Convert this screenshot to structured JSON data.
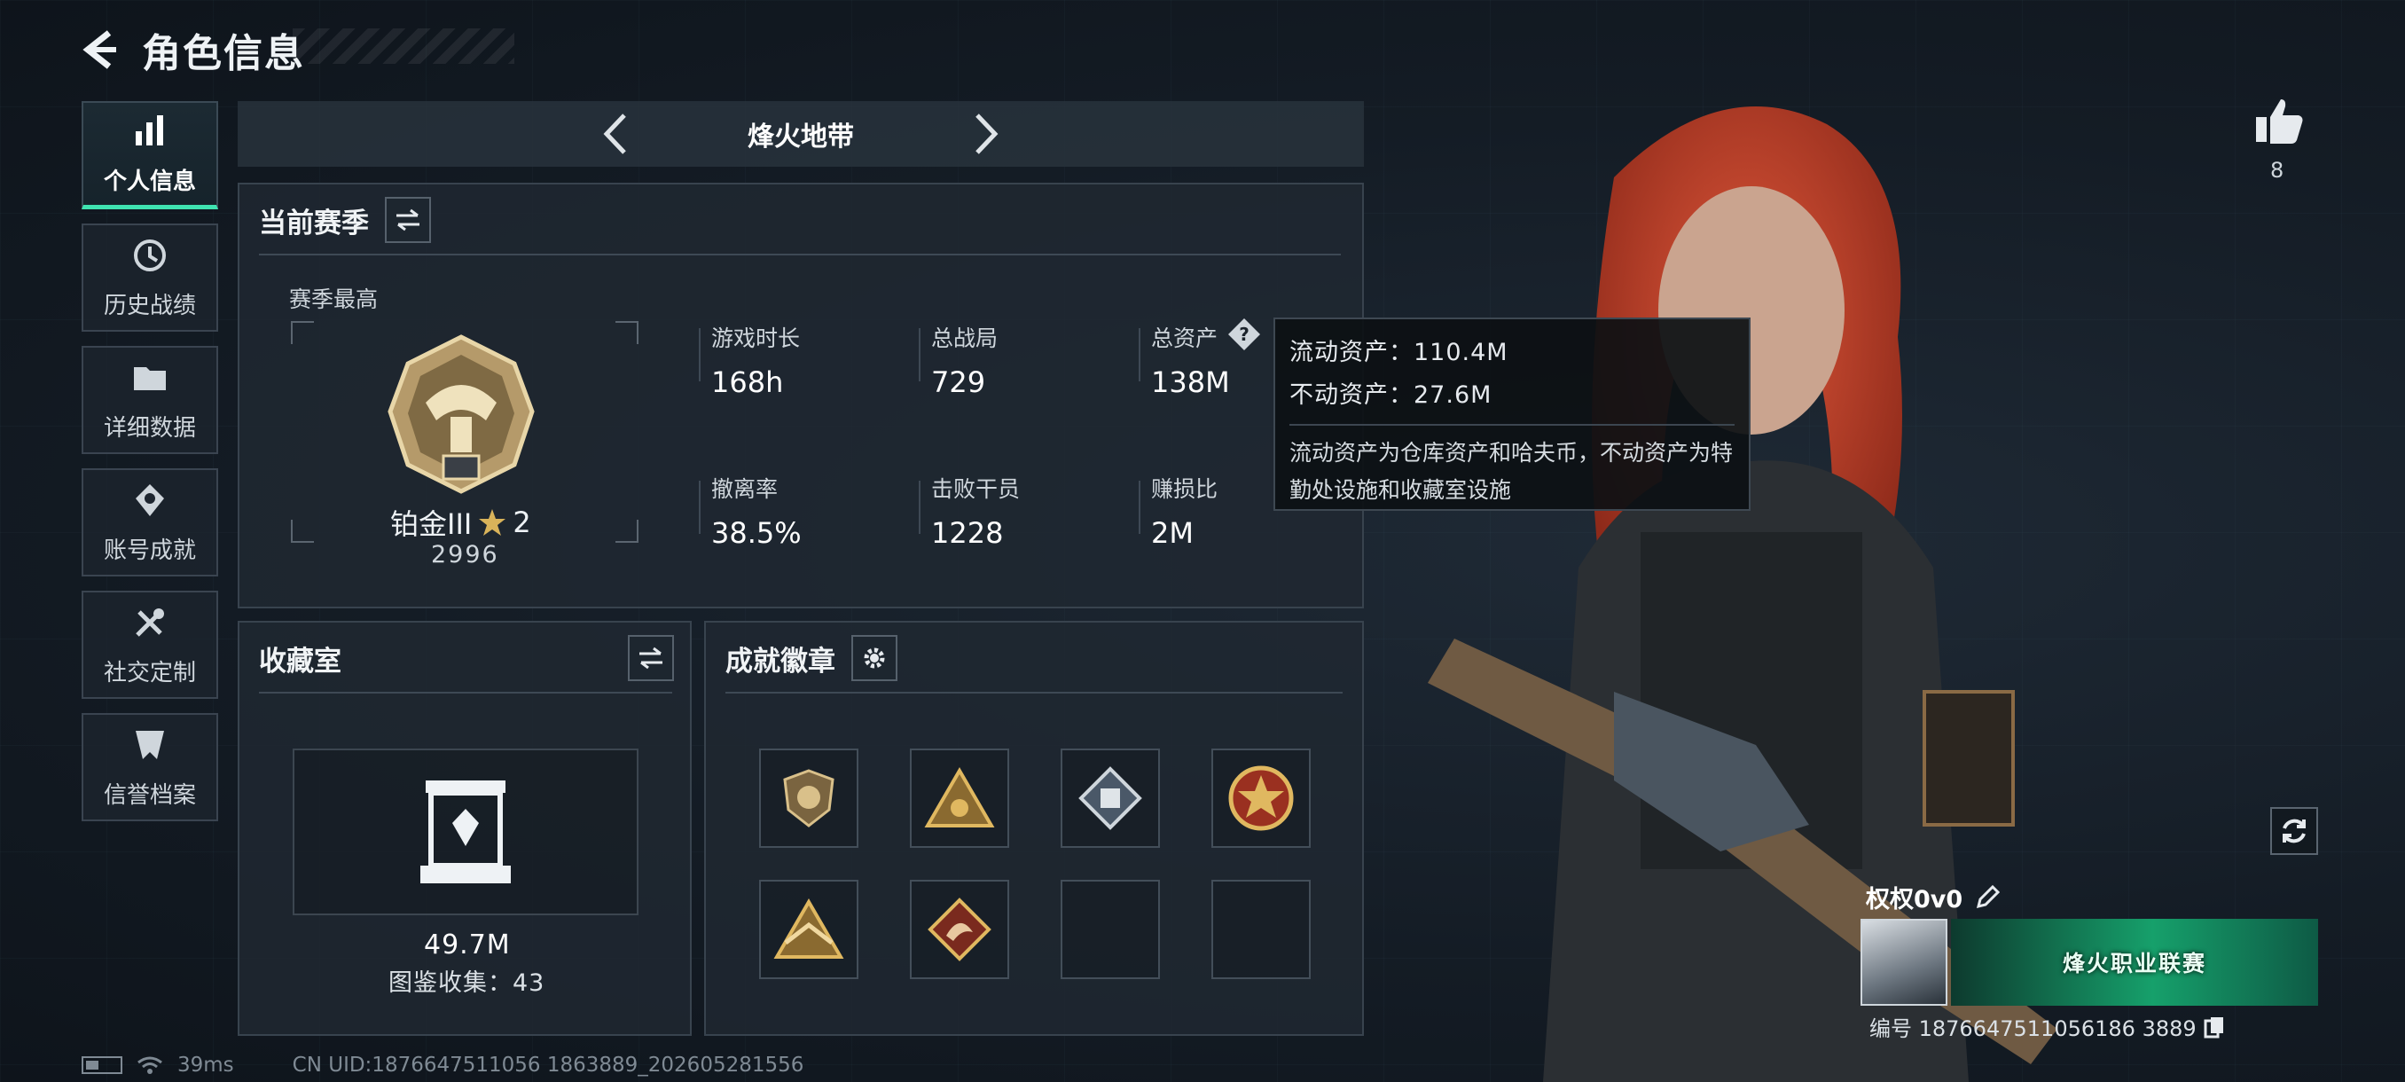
{
  "header": {
    "title": "角色信息"
  },
  "sidebar": {
    "items": [
      {
        "label": "个人信息",
        "icon": "bar-chart-icon",
        "active": true
      },
      {
        "label": "历史战绩",
        "icon": "history-icon"
      },
      {
        "label": "详细数据",
        "icon": "folder-icon"
      },
      {
        "label": "账号成就",
        "icon": "achievement-icon"
      },
      {
        "label": "社交定制",
        "icon": "tools-icon"
      },
      {
        "label": "信誉档案",
        "icon": "shield-icon"
      }
    ]
  },
  "mode": {
    "title": "烽火地带"
  },
  "season": {
    "title": "当前赛季",
    "best_label": "赛季最高",
    "rank_name": "铂金III",
    "rank_stars": "2",
    "rank_score": "2996",
    "stats": [
      {
        "key": "游戏时长",
        "value": "168h"
      },
      {
        "key": "总战局",
        "value": "729"
      },
      {
        "key": "总资产",
        "value": "138M"
      },
      {
        "key": "撤离率",
        "value": "38.5%"
      },
      {
        "key": "击败干员",
        "value": "1228"
      },
      {
        "key": "赚损比",
        "value": "2M"
      }
    ]
  },
  "tooltip": {
    "liquid": "流动资产：110.4M",
    "fixed": "不动资产：27.6M",
    "note": "流动资产为仓库资产和哈夫币，不动资产为特勤处设施和收藏室设施"
  },
  "collection": {
    "title": "收藏室",
    "value": "49.7M",
    "count": "图鉴收集：43"
  },
  "badges": {
    "title": "成就徽章"
  },
  "player": {
    "likes": "8",
    "name": "权权0v0",
    "banner_text": "烽火职业联赛",
    "id": "编号 1876647511056186 3889"
  },
  "footer": {
    "ping": "39ms",
    "uid": "CN UID:1876647511056 1863889_202605281556"
  },
  "colors": {
    "accent": "#3fe3b0",
    "hair": "#c9432a"
  }
}
